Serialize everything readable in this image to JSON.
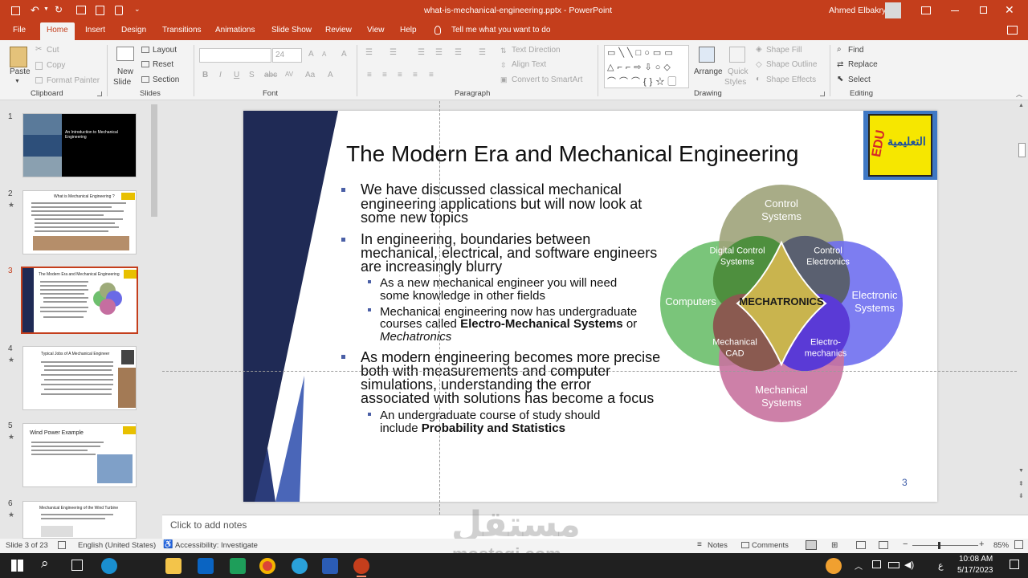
{
  "window": {
    "title": "what-is-mechanical-engineering.pptx - PowerPoint",
    "user": "Ahmed Elbakry"
  },
  "menu": {
    "tabs": [
      "File",
      "Home",
      "Insert",
      "Design",
      "Transitions",
      "Animations",
      "Slide Show",
      "Review",
      "View",
      "Help"
    ],
    "tell_me": "Tell me what you want to do"
  },
  "ribbon": {
    "clipboard": {
      "paste": "Paste",
      "cut": "Cut",
      "copy": "Copy",
      "format_painter": "Format Painter",
      "label": "Clipboard"
    },
    "slides": {
      "new_slide_1": "New",
      "new_slide_2": "Slide",
      "layout": "Layout",
      "reset": "Reset",
      "section": "Section",
      "label": "Slides"
    },
    "font": {
      "font_size": "24",
      "label": "Font"
    },
    "paragraph": {
      "text_direction": "Text Direction",
      "align_text": "Align Text",
      "smartart": "Convert to SmartArt",
      "label": "Paragraph"
    },
    "drawing": {
      "arrange": "Arrange",
      "quick_styles_1": "Quick",
      "quick_styles_2": "Styles",
      "shape_fill": "Shape Fill",
      "shape_outline": "Shape Outline",
      "shape_effects": "Shape Effects",
      "label": "Drawing"
    },
    "editing": {
      "find": "Find",
      "replace": "Replace",
      "select": "Select",
      "label": "Editing"
    }
  },
  "thumbnails": [
    {
      "num": "1",
      "title": "An Introduction to Mechanical Engineering"
    },
    {
      "num": "2",
      "title": "What is Mechanical Engineering ?"
    },
    {
      "num": "3",
      "title": "The Modern Era and Mechanical Engineering"
    },
    {
      "num": "4",
      "title": "Typical Jobs of A Mechanical Engineer"
    },
    {
      "num": "5",
      "title": "Wind Power Example"
    },
    {
      "num": "6",
      "title": "Mechanical Engineering of the Wind Turbine"
    }
  ],
  "slide": {
    "title": "The Modern Era and Mechanical Engineering",
    "logo_left": "EDU",
    "logo_right": "التعليمية",
    "bullets": [
      {
        "lines": [
          "We have discussed classical mechanical",
          "engineering applications but will now look at",
          "some new topics"
        ]
      },
      {
        "lines": [
          "In engineering, boundaries between",
          "mechanical, electrical, and software engineers",
          "are increasingly blurry"
        ]
      },
      {
        "lines": [
          "As modern engineering becomes more precise",
          "both with measurements and computer",
          "simulations, understanding  the error",
          "associated with solutions has become a focus"
        ]
      }
    ],
    "sub1": [
      "As a new mechanical engineer you will need",
      "some knowledge in other fields"
    ],
    "sub2": {
      "l1": "Mechanical engineering now has undergraduate",
      "l2a": "courses called ",
      "l2b": "Electro-Mechanical Systems",
      "l2c": " or",
      "l3": "Mechatronics"
    },
    "sub3": {
      "l1": "An undergraduate course of study should",
      "l2a": "include ",
      "l2b": "Probability and Statistics"
    },
    "page_number": "3",
    "venn": {
      "control_systems": [
        "Control",
        "Systems"
      ],
      "electronic_systems": [
        "Electronic",
        "Systems"
      ],
      "mechanical_systems": [
        "Mechanical",
        "Systems"
      ],
      "computers": "Computers",
      "digital_control": [
        "Digital Control",
        "Systems"
      ],
      "control_electronics": [
        "Control",
        "Electronics"
      ],
      "mechanical_cad": [
        "Mechanical",
        "CAD"
      ],
      "electromechanics": [
        "Electro-",
        "mechanics"
      ],
      "center": "MECHATRONICS"
    }
  },
  "notes": {
    "placeholder": "Click to add notes"
  },
  "status": {
    "slide_info": "Slide 3 of 23",
    "language": "English (United States)",
    "accessibility": "Accessibility: Investigate",
    "notes": "Notes",
    "comments": "Comments",
    "zoom": "85%"
  },
  "watermark": {
    "arabic": "مستقل",
    "latin": "mostaqi.com"
  },
  "taskbar": {
    "time": "10:08 AM",
    "date": "5/17/2023",
    "lang": "ع"
  }
}
